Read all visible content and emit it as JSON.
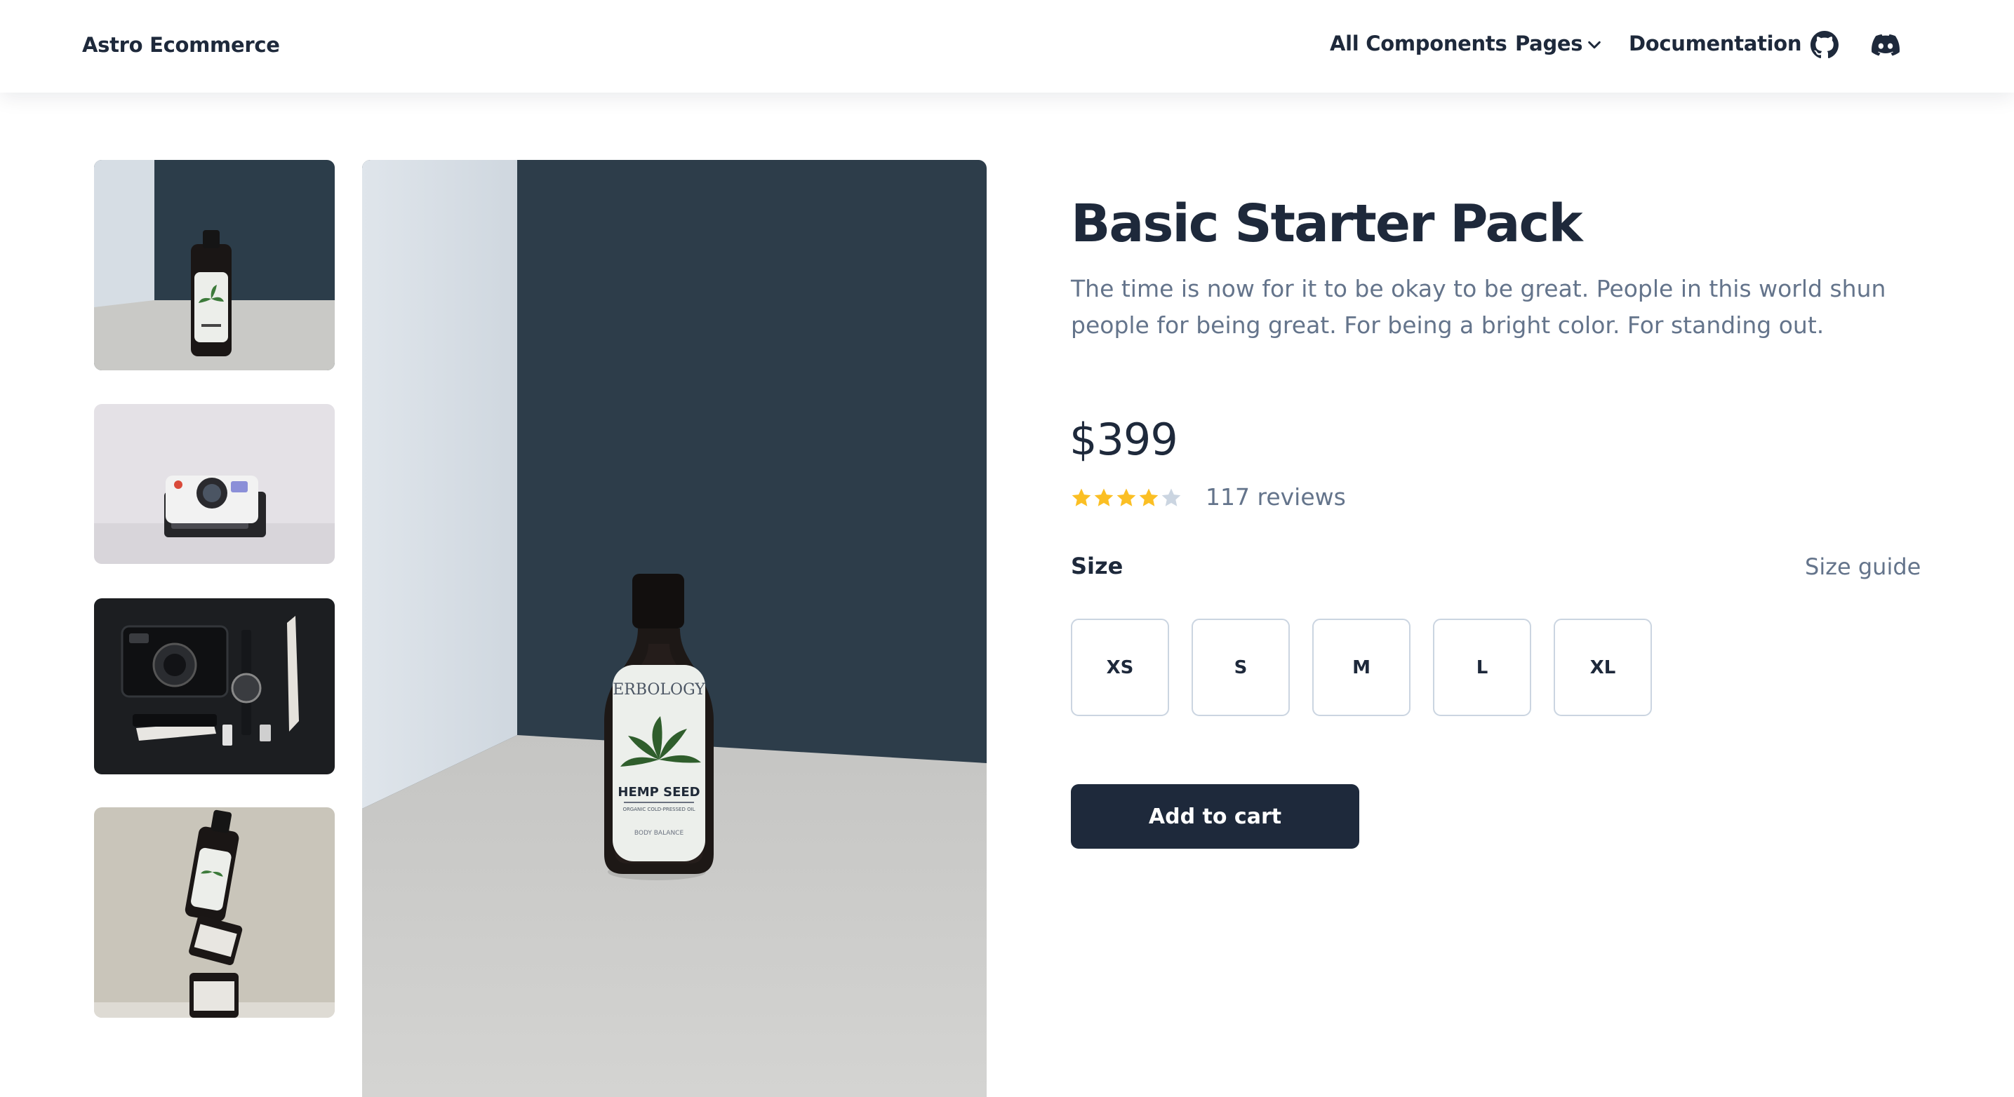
{
  "navbar": {
    "brand": "Astro Ecommerce",
    "links": [
      "All Components",
      "Pages",
      "Documentation"
    ],
    "icons": [
      "github-icon",
      "discord-icon"
    ]
  },
  "gallery": {
    "thumbnails": [
      "hemp-seed-bottle",
      "instant-camera",
      "camera-watch-knife-flatlay",
      "stacked-hemp-seed-jars"
    ],
    "main_image": "hemp-seed-bottle",
    "label_brand": "ERBOLOGY",
    "label_product": "HEMP SEED",
    "label_sub": "ORGANIC COLD-PRESSED OIL",
    "label_body": "BODY BALANCE"
  },
  "product": {
    "title": "Basic Starter Pack",
    "description": "The time is now for it to be okay to be great. People in this world shun people for being great. For being a bright color. For standing out.",
    "price": "$399",
    "rating": 4,
    "rating_max": 5,
    "reviews": "117 reviews",
    "size_label": "Size",
    "size_guide": "Size guide",
    "sizes": [
      "XS",
      "S",
      "M",
      "L",
      "XL"
    ],
    "add_to_cart": "Add to cart"
  },
  "colors": {
    "primary": "#1e293b",
    "muted_text": "#64748b",
    "star_filled": "#fbbf24",
    "star_empty": "#cbd5e1",
    "border": "#cbd5e1"
  }
}
